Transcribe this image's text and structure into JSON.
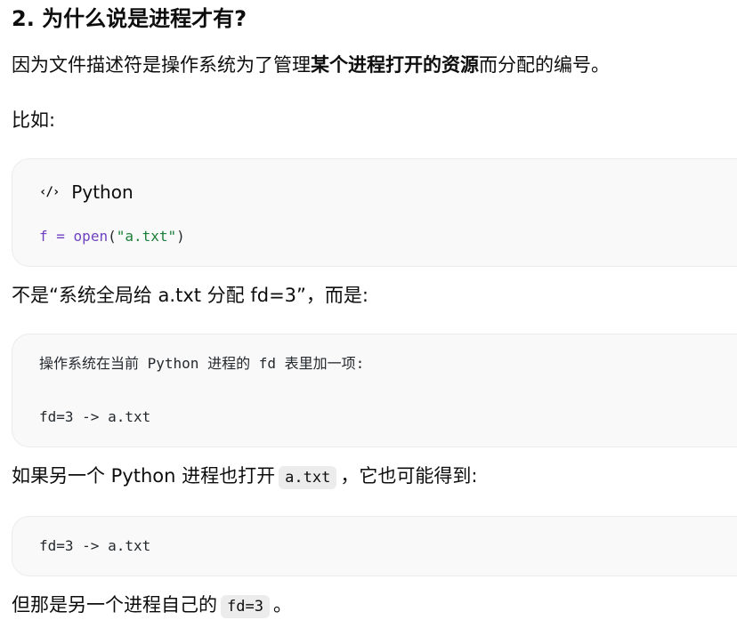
{
  "heading": "2. 为什么说是进程才有?",
  "p1": {
    "before": "因为文件描述符是操作系统为了管理",
    "bold": "某个进程打开的资源",
    "after": "而分配的编号。"
  },
  "p2": "比如:",
  "code1": {
    "icon": "‹/›",
    "language": "Python",
    "tokens": {
      "var": "f",
      "op": " = ",
      "fn": "open",
      "lparen": "(",
      "str": "\"a.txt\"",
      "rparen": ")"
    }
  },
  "p3": "不是“系统全局给 a.txt 分配 fd=3”，而是:",
  "code2": {
    "line1": "操作系统在当前 Python 进程的 fd 表里加一项:",
    "line2": "fd=3 -> a.txt"
  },
  "p4": {
    "before": "如果另一个 Python 进程也打开",
    "code": "a.txt",
    "after": "，它也可能得到:"
  },
  "code3": {
    "line1": "fd=3 -> a.txt"
  },
  "p5": {
    "before": "但那是另一个进程自己的",
    "code": "fd=3",
    "after": "。"
  }
}
